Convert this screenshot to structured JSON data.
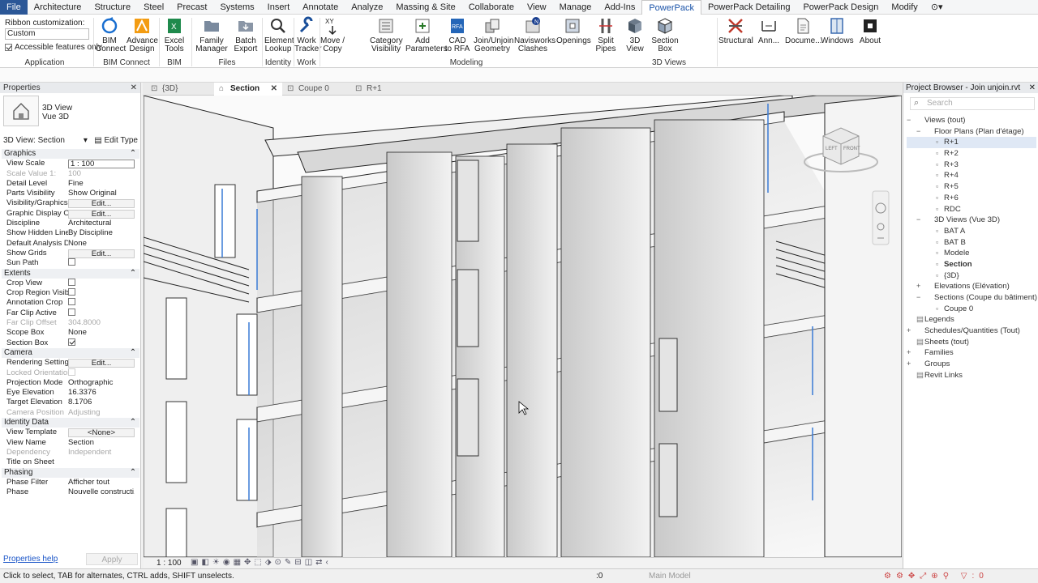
{
  "menubar": {
    "tabs": [
      "File",
      "Architecture",
      "Structure",
      "Steel",
      "Precast",
      "Systems",
      "Insert",
      "Annotate",
      "Analyze",
      "Massing & Site",
      "Collaborate",
      "View",
      "Manage",
      "Add-Ins",
      "PowerPack",
      "PowerPack Detailing",
      "PowerPack Design",
      "Modify"
    ],
    "active": "PowerPack"
  },
  "ribbon": {
    "customization_label": "Ribbon customization:",
    "customization_value": "Custom",
    "accessible_label": "Accessible features only",
    "panels": {
      "application": "Application",
      "bim_connect": "BIM Connect",
      "bim_data": "BIM Data",
      "files": "Files",
      "identity": "Identity",
      "work": "Work",
      "modeling": "Modeling",
      "views_3d": "3D Views"
    },
    "buttons": {
      "bim_connect": "BIM Connect",
      "advance_design": "Advance Design",
      "excel_tools": "Excel Tools",
      "family_manager": "Family Manager",
      "batch_export": "Batch Export",
      "element_lookup": "Element Lookup",
      "work_tracker": "Work Tracker",
      "move_copy": "Move / Copy",
      "category_visibility": "Category Visibility",
      "add_parameters": "Add Parameters",
      "cad_to_rfa": "CAD to RFA",
      "join_unjoin": "Join/Unjoin Geometry",
      "navisworks_clashes": "Navisworks Clashes",
      "openings": "Openings",
      "split_pipes": "Split Pipes",
      "view_3d": "3D View",
      "section_box": "Section Box",
      "structural": "Structural",
      "annotation": "Ann...",
      "documentation": "Docume...",
      "windows": "Windows",
      "about": "About"
    }
  },
  "properties": {
    "title": "Properties",
    "type_line1": "3D View",
    "type_line2": "Vue 3D",
    "instance": "3D View: Section",
    "edit_type": "Edit Type",
    "groups": [
      {
        "name": "Graphics",
        "rows": [
          {
            "k": "View Scale",
            "v": "1 : 100",
            "style": "boxed"
          },
          {
            "k": "Scale Value   1:",
            "v": "100",
            "style": "grey"
          },
          {
            "k": "Detail Level",
            "v": "Fine"
          },
          {
            "k": "Parts Visibility",
            "v": "Show Original"
          },
          {
            "k": "Visibility/Graphics ...",
            "v": "Edit...",
            "style": "btn"
          },
          {
            "k": "Graphic Display O...",
            "v": "Edit...",
            "style": "btn"
          },
          {
            "k": "Discipline",
            "v": "Architectural"
          },
          {
            "k": "Show Hidden Lines",
            "v": "By Discipline"
          },
          {
            "k": "Default Analysis Di...",
            "v": "None"
          },
          {
            "k": "Show Grids",
            "v": "Edit...",
            "style": "btn"
          },
          {
            "k": "Sun Path",
            "v": "",
            "style": "check"
          }
        ]
      },
      {
        "name": "Extents",
        "rows": [
          {
            "k": "Crop View",
            "v": "",
            "style": "check"
          },
          {
            "k": "Crop Region Visible",
            "v": "",
            "style": "check"
          },
          {
            "k": "Annotation Crop",
            "v": "",
            "style": "check"
          },
          {
            "k": "Far Clip Active",
            "v": "",
            "style": "check"
          },
          {
            "k": "Far Clip Offset",
            "v": "304.8000",
            "style": "grey"
          },
          {
            "k": "Scope Box",
            "v": "None"
          },
          {
            "k": "Section Box",
            "v": "",
            "style": "checkon"
          }
        ]
      },
      {
        "name": "Camera",
        "rows": [
          {
            "k": "Rendering Settings",
            "v": "Edit...",
            "style": "btn"
          },
          {
            "k": "Locked Orientation",
            "v": "",
            "style": "greycheck"
          },
          {
            "k": "Projection Mode",
            "v": "Orthographic"
          },
          {
            "k": "Eye Elevation",
            "v": "16.3376"
          },
          {
            "k": "Target Elevation",
            "v": "8.1706"
          },
          {
            "k": "Camera Position",
            "v": "Adjusting",
            "style": "grey"
          }
        ]
      },
      {
        "name": "Identity Data",
        "rows": [
          {
            "k": "View Template",
            "v": "<None>",
            "style": "btn"
          },
          {
            "k": "View Name",
            "v": "Section"
          },
          {
            "k": "Dependency",
            "v": "Independent",
            "style": "grey"
          },
          {
            "k": "Title on Sheet",
            "v": ""
          }
        ]
      },
      {
        "name": "Phasing",
        "rows": [
          {
            "k": "Phase Filter",
            "v": "Afficher tout"
          },
          {
            "k": "Phase",
            "v": "Nouvelle constructi..."
          }
        ]
      }
    ],
    "help": "Properties help",
    "apply": "Apply"
  },
  "view_tabs": [
    {
      "label": "{3D}",
      "active": false
    },
    {
      "label": "Section",
      "active": true
    },
    {
      "label": "Coupe 0",
      "active": false
    },
    {
      "label": "R+1",
      "active": false
    }
  ],
  "view_scale": "1 : 100",
  "viewcube": {
    "left": "LEFT",
    "front": "FRONT"
  },
  "browser": {
    "title": "Project Browser - Join unjoin.rvt",
    "search_placeholder": "Search",
    "tree": [
      {
        "label": "Views (tout)",
        "indent": 0,
        "exp": "−"
      },
      {
        "label": "Floor Plans (Plan d'étage)",
        "indent": 1,
        "exp": "−"
      },
      {
        "label": "R+1",
        "indent": 2,
        "sel": true
      },
      {
        "label": "R+2",
        "indent": 2
      },
      {
        "label": "R+3",
        "indent": 2
      },
      {
        "label": "R+4",
        "indent": 2
      },
      {
        "label": "R+5",
        "indent": 2
      },
      {
        "label": "R+6",
        "indent": 2
      },
      {
        "label": "RDC",
        "indent": 2
      },
      {
        "label": "3D Views (Vue 3D)",
        "indent": 1,
        "exp": "−"
      },
      {
        "label": "BAT A",
        "indent": 2
      },
      {
        "label": "BAT B",
        "indent": 2
      },
      {
        "label": "Modele",
        "indent": 2
      },
      {
        "label": "Section",
        "indent": 2,
        "bold": true
      },
      {
        "label": "{3D}",
        "indent": 2
      },
      {
        "label": "Elevations (Elévation)",
        "indent": 1,
        "exp": "+"
      },
      {
        "label": "Sections (Coupe du bâtiment)",
        "indent": 1,
        "exp": "−"
      },
      {
        "label": "Coupe 0",
        "indent": 2
      },
      {
        "label": "Legends",
        "indent": 0
      },
      {
        "label": "Schedules/Quantities (Tout)",
        "indent": 0,
        "exp": "+"
      },
      {
        "label": "Sheets (tout)",
        "indent": 0
      },
      {
        "label": "Families",
        "indent": 0,
        "exp": "+"
      },
      {
        "label": "Groups",
        "indent": 0,
        "exp": "+"
      },
      {
        "label": "Revit Links",
        "indent": 0
      }
    ]
  },
  "status": {
    "message": "Click to select, TAB for alternates, CTRL adds, SHIFT unselects.",
    "model": "Main Model",
    "zero": ":0"
  }
}
